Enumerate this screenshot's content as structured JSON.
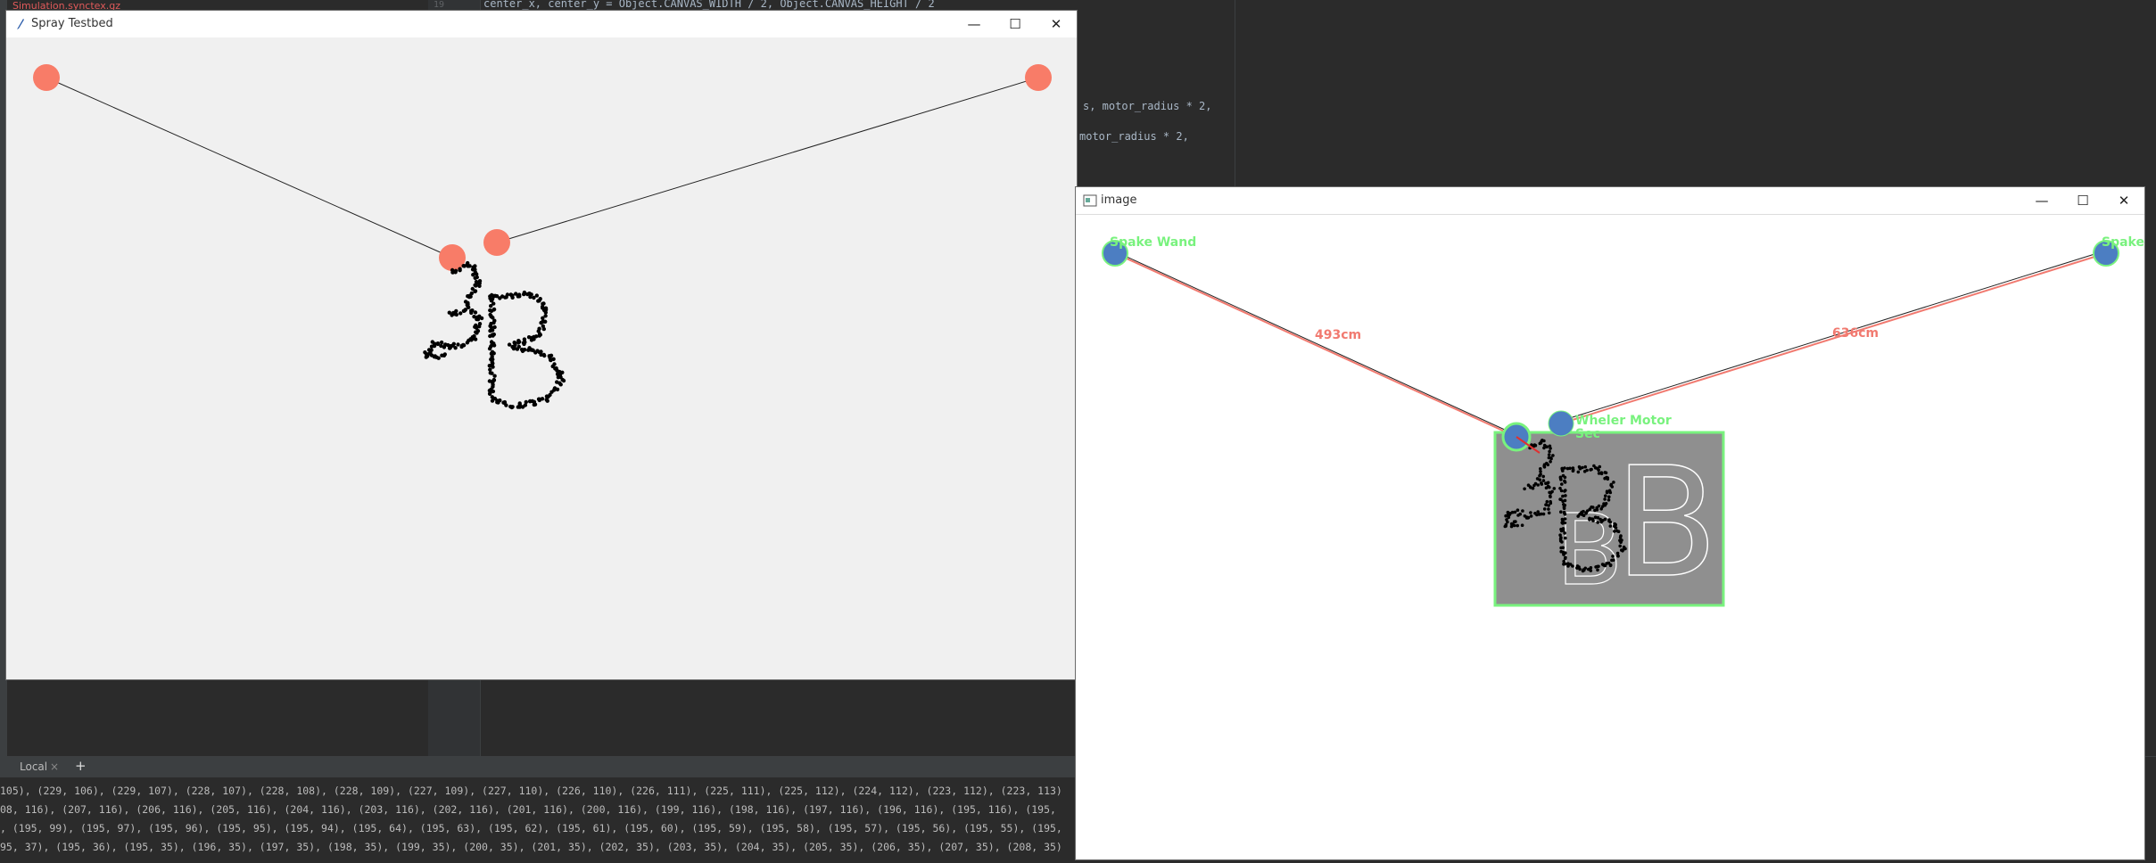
{
  "ide": {
    "file_tab": "Simulation.synctex.gz",
    "line_number_hint": "19",
    "code_lines": [
      "center_x, center_y = Object.CANVAS_WIDTH / 2, Object.CANVAS_HEIGHT / 2",
      "s, motor_radius * 2,",
      "motor_radius * 2,"
    ],
    "accent_color": "#e05a5a"
  },
  "terminal": {
    "tab_label": "Local",
    "add_tab": "+",
    "close_tab": "×",
    "lines": [
      "105), (229, 106), (229, 107), (228, 107), (228, 108), (228, 109), (227, 109), (227, 110), (226, 110), (226, 111), (225, 111), (225, 112), (224, 112), (223, 112), (223, 113)",
      "08, 116), (207, 116), (206, 116), (205, 116), (204, 116), (203, 116), (202, 116), (201, 116), (200, 116), (199, 116), (198, 116), (197, 116), (196, 116), (195, 116), (195,",
      ", (195, 99), (195, 97), (195, 96), (195, 95), (195, 94), (195, 64), (195, 63), (195, 62), (195, 61), (195, 60), (195, 59), (195, 58), (195, 57), (195, 56), (195, 55), (195,",
      "95, 37), (195, 36), (195, 35), (196, 35), (197, 35), (198, 35), (199, 35), (200, 35), (201, 35), (202, 35), (203, 35), (204, 35), (205, 35), (206, 35), (207, 35), (208, 35)"
    ]
  },
  "spray_window": {
    "title": "Spray Testbed",
    "minimize": "—",
    "maximize": "☐",
    "close": "✕",
    "motor_color": "#f87c68",
    "background": "#f0f0f0"
  },
  "image_window": {
    "title": "image",
    "minimize": "—",
    "maximize": "☐",
    "close": "✕",
    "labels": {
      "left_anchor": "Spake Wand",
      "right_anchor": "Spake",
      "carriage": "Wheler Motor",
      "carriage_sub": "Sec"
    },
    "distances": {
      "left": "493cm",
      "right": "636cm"
    },
    "big_letter": "B",
    "label_color": "#79f27e",
    "distance_color": "#f17a70",
    "node_color": "#4c7ec2",
    "box_fill": "#8f8f8f"
  }
}
